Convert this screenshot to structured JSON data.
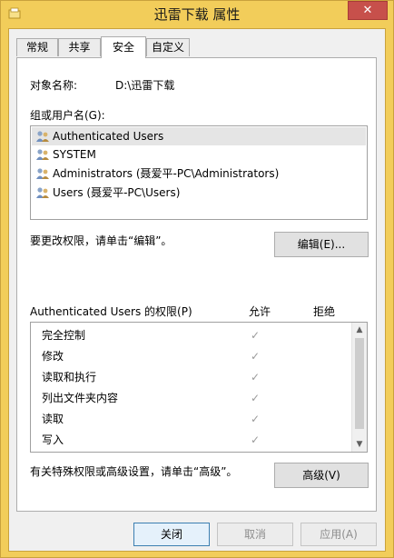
{
  "window": {
    "title": "迅雷下载 属性",
    "close_glyph": "✕"
  },
  "tabs": [
    {
      "label": "常规"
    },
    {
      "label": "共享"
    },
    {
      "label": "安全",
      "active": true
    },
    {
      "label": "自定义"
    }
  ],
  "security": {
    "object_name_label": "对象名称:",
    "object_name_value": "D:\\迅雷下载",
    "group_users_label": "组或用户名(G):",
    "users": [
      {
        "name": "Authenticated Users",
        "selected": true
      },
      {
        "name": "SYSTEM"
      },
      {
        "name": "Administrators (聂爱平-PC\\Administrators)"
      },
      {
        "name": "Users (聂爱平-PC\\Users)"
      }
    ],
    "change_perm_text": "要更改权限，请单击“编辑”。",
    "edit_button": "编辑(E)...",
    "perm_title": "Authenticated Users 的权限(P)",
    "allow_header": "允许",
    "deny_header": "拒绝",
    "permissions": [
      {
        "name": "完全控制",
        "allow": "✓"
      },
      {
        "name": "修改",
        "allow": "✓"
      },
      {
        "name": "读取和执行",
        "allow": "✓"
      },
      {
        "name": "列出文件夹内容",
        "allow": "✓"
      },
      {
        "name": "读取",
        "allow": "✓"
      },
      {
        "name": "写入",
        "allow": "✓"
      }
    ],
    "advanced_text": "有关特殊权限或高级设置，请单击“高级”。",
    "advanced_button": "高级(V)"
  },
  "footer": {
    "close_button": "关闭",
    "cancel_button": "取消",
    "apply_button": "应用(A)"
  },
  "scrollbar": {
    "up": "▲",
    "down": "▼"
  },
  "colors": {
    "titlebar": "#f2cd5a",
    "close_button": "#c7504b"
  }
}
